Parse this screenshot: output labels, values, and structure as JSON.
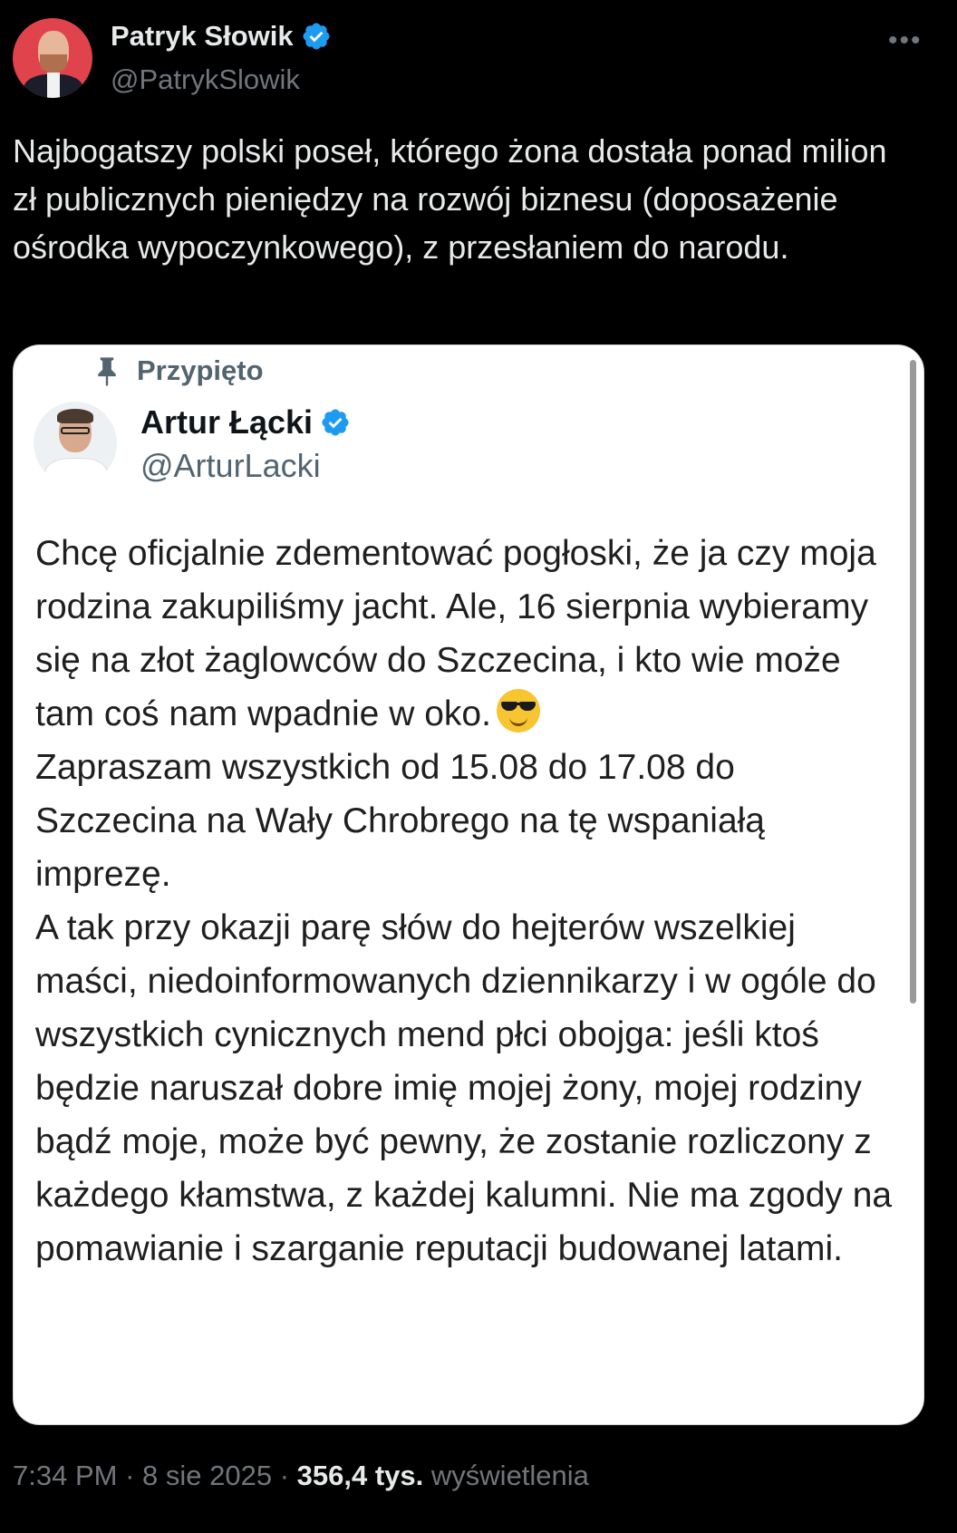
{
  "author": {
    "name": "Patryk Słowik",
    "handle": "@PatrykSlowik"
  },
  "more_label": "•••",
  "tweet_text": "Najbogatszy polski poseł, którego żona dostała ponad milion zł publicznych pieniędzy na rozwój biznesu (doposażenie ośrodka wypoczynkowego), z przesłaniem do narodu.",
  "quoted": {
    "pinned_label": "Przypięto",
    "name": "Artur Łącki",
    "handle": "@ArturLacki",
    "text_part1": "Chcę oficjalnie zdementować pogłoski, że ja czy moja rodzina zakupiliśmy jacht. Ale,  16 sierpnia wybieramy się na złot żaglowców do Szczecina, i kto wie może tam  coś nam wpadnie w oko.",
    "emoji": "smiling-face-with-sunglasses",
    "text_part2": "\nZapraszam wszystkich od 15.08 do 17.08 do Szczecina na Wały Chrobrego na tę wspaniałą imprezę.\nA tak przy okazji parę słów do hejterów wszelkiej maści, niedoinformowanych dziennikarzy i w ogóle do wszystkich cynicznych mend płci obojga: jeśli ktoś będzie naruszał dobre imię mojej żony, mojej rodziny bądź moje, może być pewny, że  zostanie rozliczony z każdego kłamstwa, z każdej kalumni. Nie ma zgody na pomawianie i szarganie reputacji budowanej latami."
  },
  "meta": {
    "time": "7:34 PM",
    "separator": "·",
    "date": "8 sie 2025",
    "views_count": "356,4 tys.",
    "views_label": "wyświetlenia"
  },
  "colors": {
    "background": "#000000",
    "verified_badge": "#1d9bf0",
    "avatar_bg": "#e0434b"
  }
}
